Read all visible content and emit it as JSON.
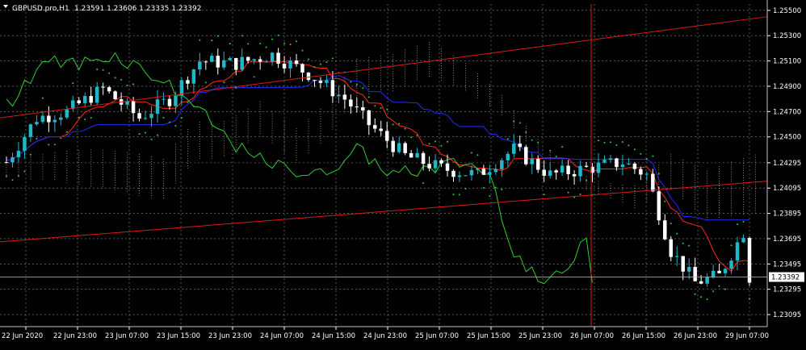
{
  "header": {
    "symbol": "GBPUSD.pro,H1",
    "ohlc": "1.23591 1.23606 1.23335 1.23392"
  },
  "colors": {
    "background": "#000000",
    "grid": "#8a8a8a",
    "bull_candle": "#1fb8c8",
    "bear_candle": "#ffffff",
    "tenkan": "#ff2a1a",
    "kijun": "#1f2cff",
    "chikou": "#33cc33",
    "psar": "#33cc33",
    "trendline": "#e01818",
    "cloud_a": "#e8c8a8",
    "cloud_b": "#e0e0e0",
    "price_line": "#c0c0c0",
    "axis_text": "#ffffff"
  },
  "chart_data": {
    "type": "candlestick",
    "symbol": "GBPUSD.pro",
    "timeframe": "H1",
    "current_price": "1.23392",
    "ylim": [
      1.23,
      1.2555
    ],
    "y_ticks": [
      "1.25500",
      "1.25300",
      "1.25100",
      "1.24900",
      "1.24700",
      "1.24500",
      "1.24295",
      "1.24095",
      "1.23895",
      "1.23695",
      "1.23495",
      "1.23295",
      "1.23095"
    ],
    "x_ticks": [
      "22 Jun 2020",
      "22 Jun 23:00",
      "23 Jun 07:00",
      "23 Jun 15:00",
      "23 Jun 23:00",
      "24 Jun 07:00",
      "24 Jun 15:00",
      "24 Jun 23:00",
      "25 Jun 07:00",
      "25 Jun 15:00",
      "25 Jun 23:00",
      "26 Jun 07:00",
      "26 Jun 15:00",
      "26 Jun 23:00",
      "29 Jun 07:00"
    ],
    "bars": 124,
    "key_levels": [
      1.2465,
      1.2528,
      1.244,
      1.242,
      1.239,
      1.234,
      1.2375,
      1.2339
    ],
    "indicators": [
      "Ichimoku (Tenkan, Kijun, Senkou A/B cloud, Chikou)",
      "Parabolic SAR",
      "Trendlines"
    ]
  }
}
